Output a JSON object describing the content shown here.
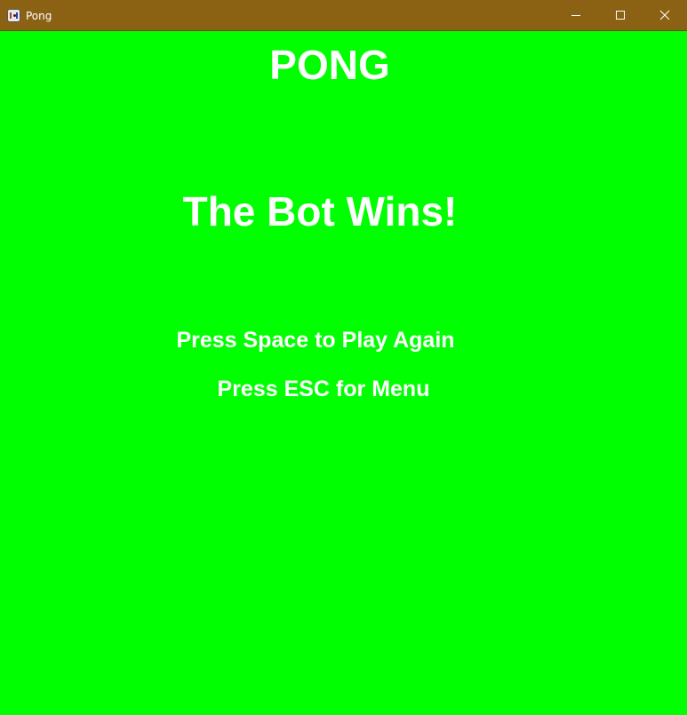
{
  "window": {
    "title": "Pong",
    "app_icon": "pong-app-icon",
    "controls": {
      "minimize_icon": "minimize-icon",
      "maximize_icon": "maximize-icon",
      "close_icon": "close-icon"
    },
    "titlebar_color": "#8b6114"
  },
  "game": {
    "title": "PONG",
    "result": "The Bot Wins!",
    "play_again_prompt": "Press Space to Play Again",
    "menu_prompt": "Press ESC for Menu",
    "background_color": "#00ff00",
    "text_color": "#ffffff"
  }
}
